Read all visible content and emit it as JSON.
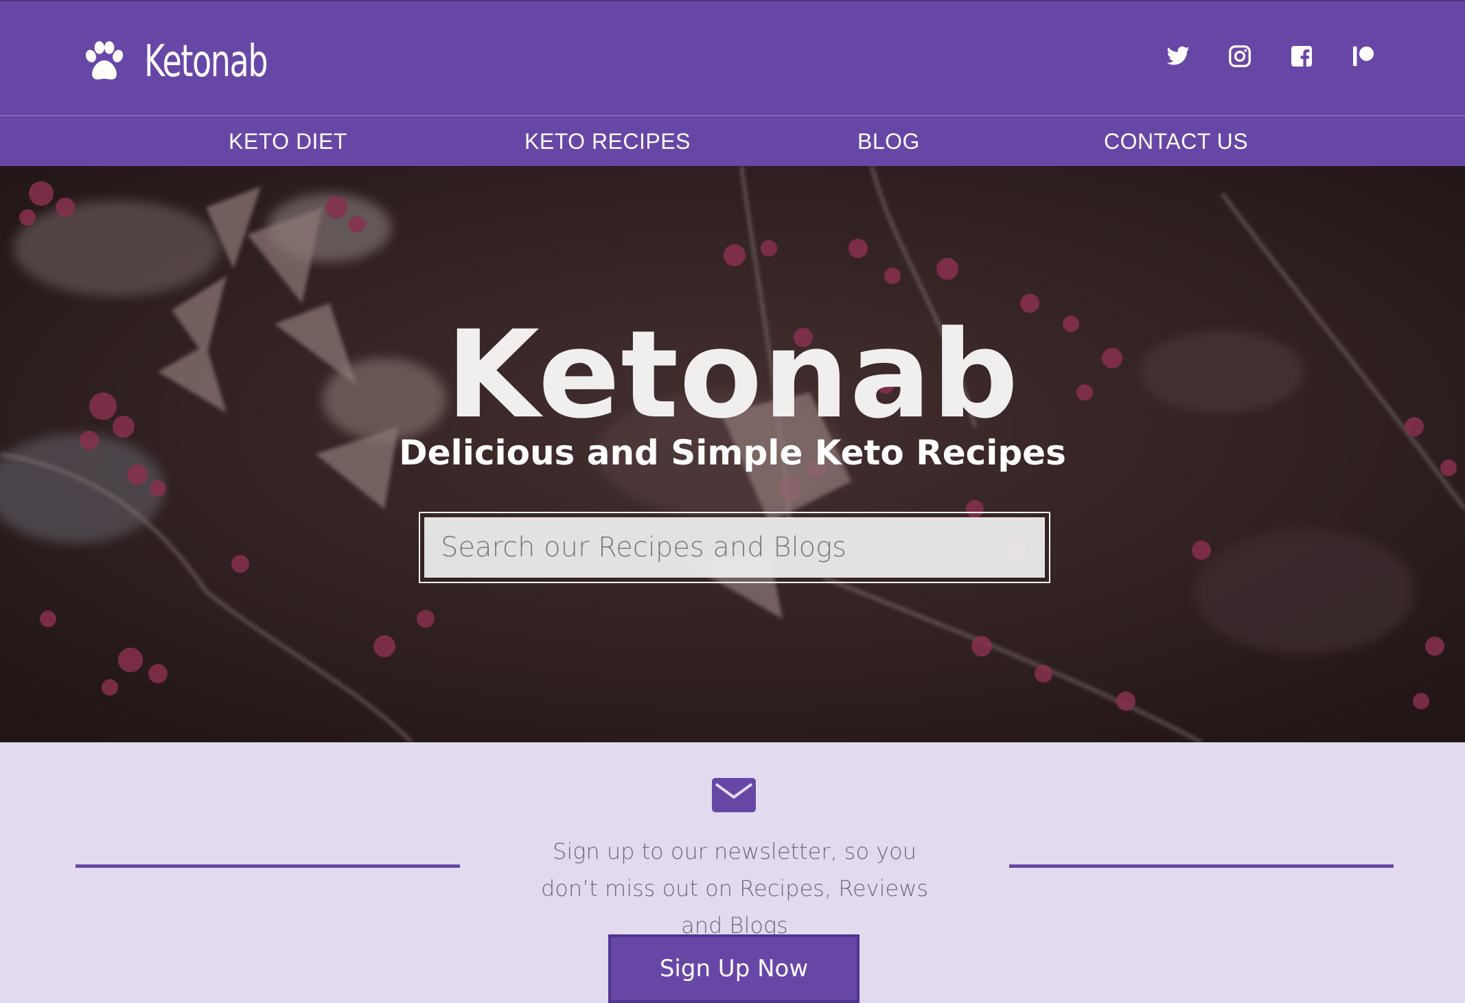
{
  "header": {
    "logo_text": "Ketonab",
    "social": [
      {
        "name": "twitter-icon"
      },
      {
        "name": "instagram-icon"
      },
      {
        "name": "facebook-icon"
      },
      {
        "name": "patreon-icon"
      }
    ]
  },
  "nav": {
    "items": [
      {
        "label": "KETO DIET"
      },
      {
        "label": "KETO RECIPES"
      },
      {
        "label": "BLOG"
      },
      {
        "label": "CONTACT US"
      }
    ]
  },
  "hero": {
    "title": "Ketonab",
    "subtitle": "Delicious and Simple Keto Recipes",
    "search": {
      "placeholder": "Search our Recipes and Blogs",
      "value": ""
    }
  },
  "newsletter": {
    "text": "Sign up to our newsletter, so you don’t miss out on Recipes, Reviews and Blogs",
    "button_label": "Sign Up Now"
  },
  "colors": {
    "brand": "#6747a6",
    "newsletter_bg": "#e2dbef"
  }
}
